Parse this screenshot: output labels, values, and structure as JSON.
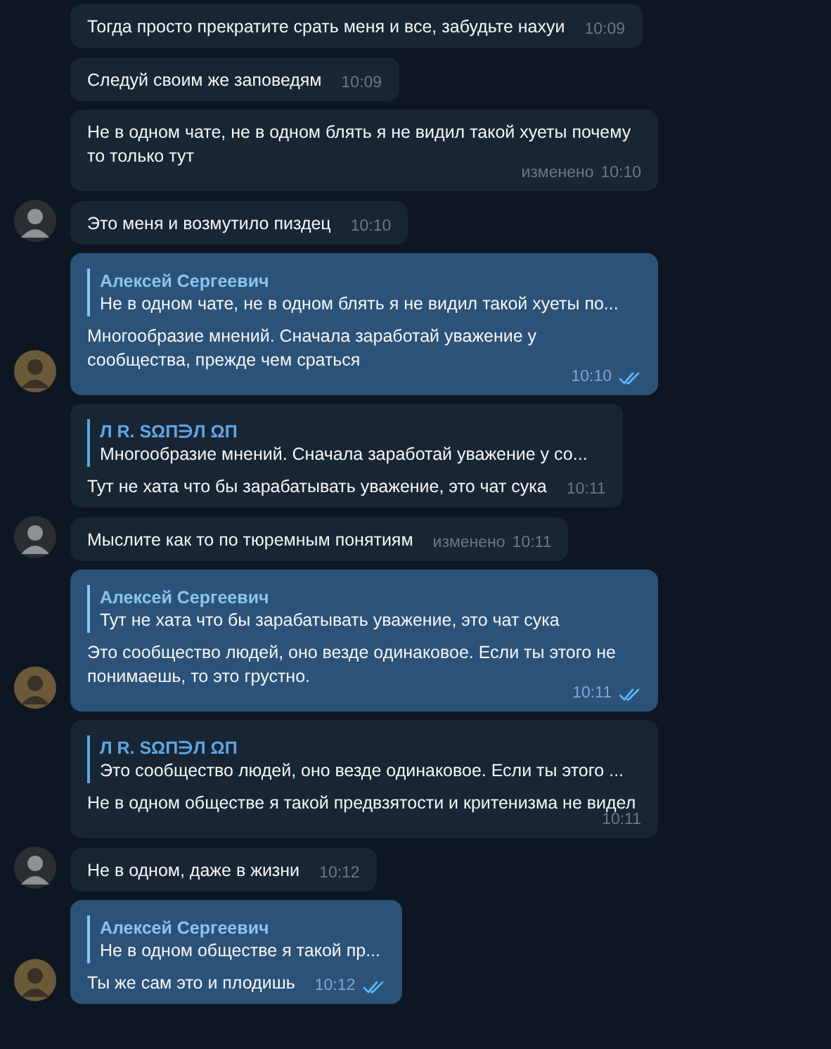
{
  "messages": [
    {
      "outgoing": false,
      "avatar": false,
      "text": "Тогда просто прекратите срать меня и все, забудьте нахуи",
      "time": "10:09"
    },
    {
      "outgoing": false,
      "avatar": false,
      "text": "Следуй своим же заповедям",
      "time": "10:09"
    },
    {
      "outgoing": false,
      "avatar": false,
      "text": "Не в одном чате, не в одном блять я не видил такой хуеты почему то только тут",
      "edited": "изменено",
      "time": "10:10"
    },
    {
      "outgoing": false,
      "avatar": true,
      "text": "Это меня и возмутило пиздец",
      "time": "10:10"
    },
    {
      "outgoing": true,
      "avatar": true,
      "reply": {
        "name": "Алексей Сергеевич",
        "text": "Не в одном чате, не в одном блять я не видил такой хуеты  по..."
      },
      "text": "Многообразие мнений. Сначала заработай уважение у сообщества, прежде чем сраться",
      "time": "10:10",
      "read": true
    },
    {
      "outgoing": false,
      "avatar": false,
      "reply": {
        "name": "Л R. SΩП∋Л ΩП",
        "text": "Многообразие мнений. Сначала заработай уважение у со..."
      },
      "text": "Тут не хата что бы зарабатывать уважение, это чат сука",
      "time": "10:11"
    },
    {
      "outgoing": false,
      "avatar": true,
      "text": "Мыслите как то по тюремным понятиям",
      "edited": "изменено",
      "time": "10:11"
    },
    {
      "outgoing": true,
      "avatar": true,
      "reply": {
        "name": "Алексей Сергеевич",
        "text": "Тут не хата что бы зарабатывать уважение, это чат сука"
      },
      "text": "Это сообщество людей, оно везде одинаковое. Если ты этого не понимаешь, то это грустно.",
      "time": "10:11",
      "read": true
    },
    {
      "outgoing": false,
      "avatar": false,
      "reply": {
        "name": "Л R. SΩП∋Л ΩП",
        "text": "Это сообщество людей, оно везде одинаковое. Если ты этого ..."
      },
      "text": "Не в одном обществе я такой предвзятости и критенизма не видел",
      "time": "10:11"
    },
    {
      "outgoing": false,
      "avatar": true,
      "text": "Не в одном, даже в жизни",
      "time": "10:12"
    },
    {
      "outgoing": true,
      "avatar": true,
      "reply": {
        "name": "Алексей Сергеевич",
        "text": "Не в одном обществе я такой пр..."
      },
      "text": "Ты же сам это и плодишь",
      "time": "10:12",
      "read": true
    }
  ]
}
